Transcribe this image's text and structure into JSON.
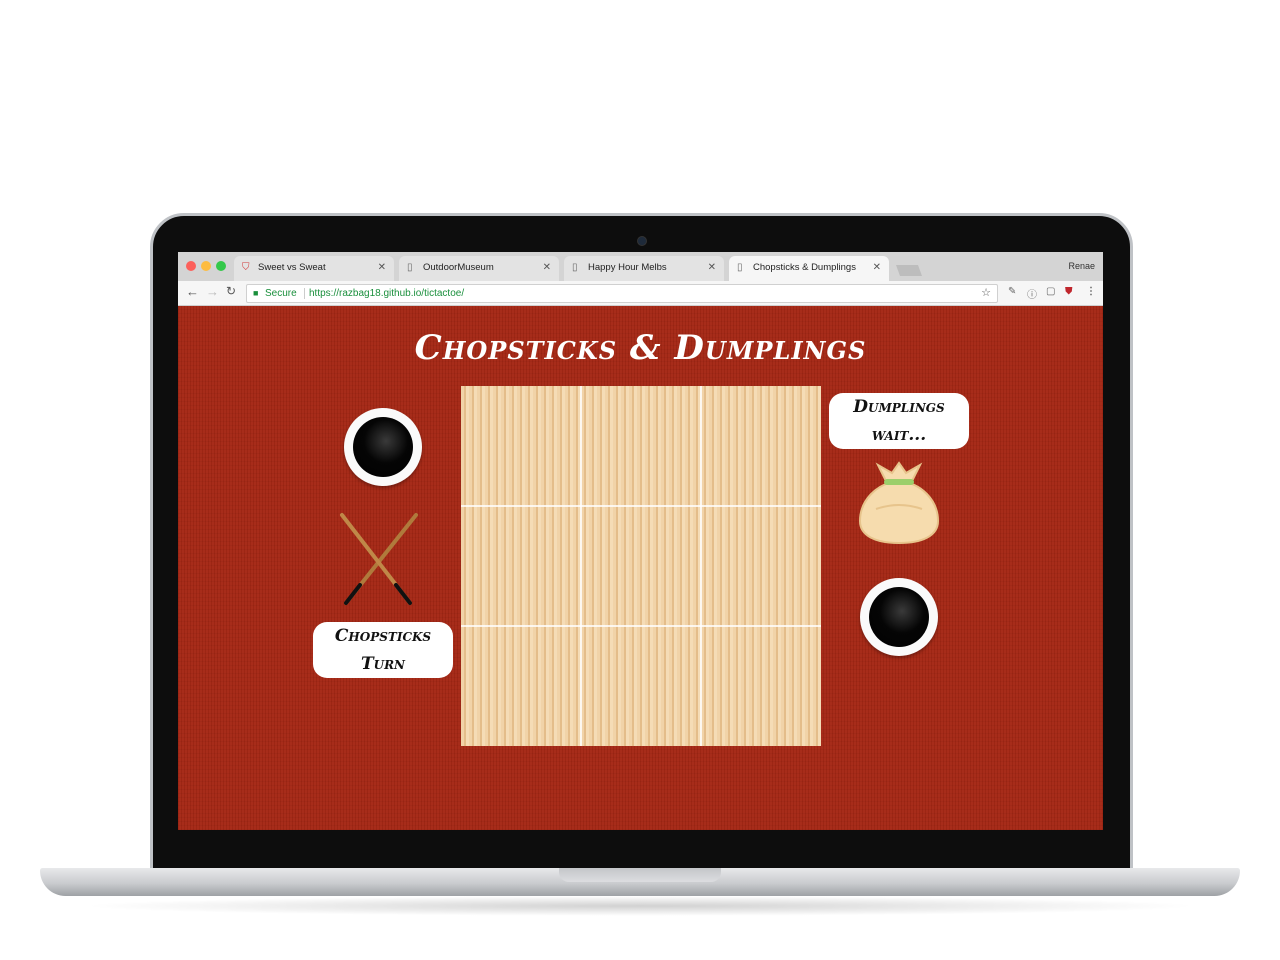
{
  "browser": {
    "tabs": [
      {
        "label": "Sweet vs Sweat",
        "icon": "shield-icon"
      },
      {
        "label": "OutdoorMuseum",
        "icon": "document-icon"
      },
      {
        "label": "Happy Hour Melbs",
        "icon": "document-icon"
      },
      {
        "label": "Chopsticks & Dumplings",
        "icon": "document-icon"
      }
    ],
    "profile_name": "Renae",
    "secure_label": "Secure",
    "url": "https://razbag18.github.io/tictactoe/"
  },
  "game": {
    "title": "Chopsticks & Dumplings",
    "chopsticks_status_line1": "Chopsticks",
    "chopsticks_status_line2": "Turn",
    "dumplings_status_line1": "Dumplings",
    "dumplings_status_line2": "wait...",
    "board": [
      "",
      "",
      "",
      "",
      "",
      "",
      "",
      "",
      ""
    ]
  },
  "colors": {
    "background": "#a52815",
    "board": "#f1d3a8",
    "text": "#ffffff"
  }
}
